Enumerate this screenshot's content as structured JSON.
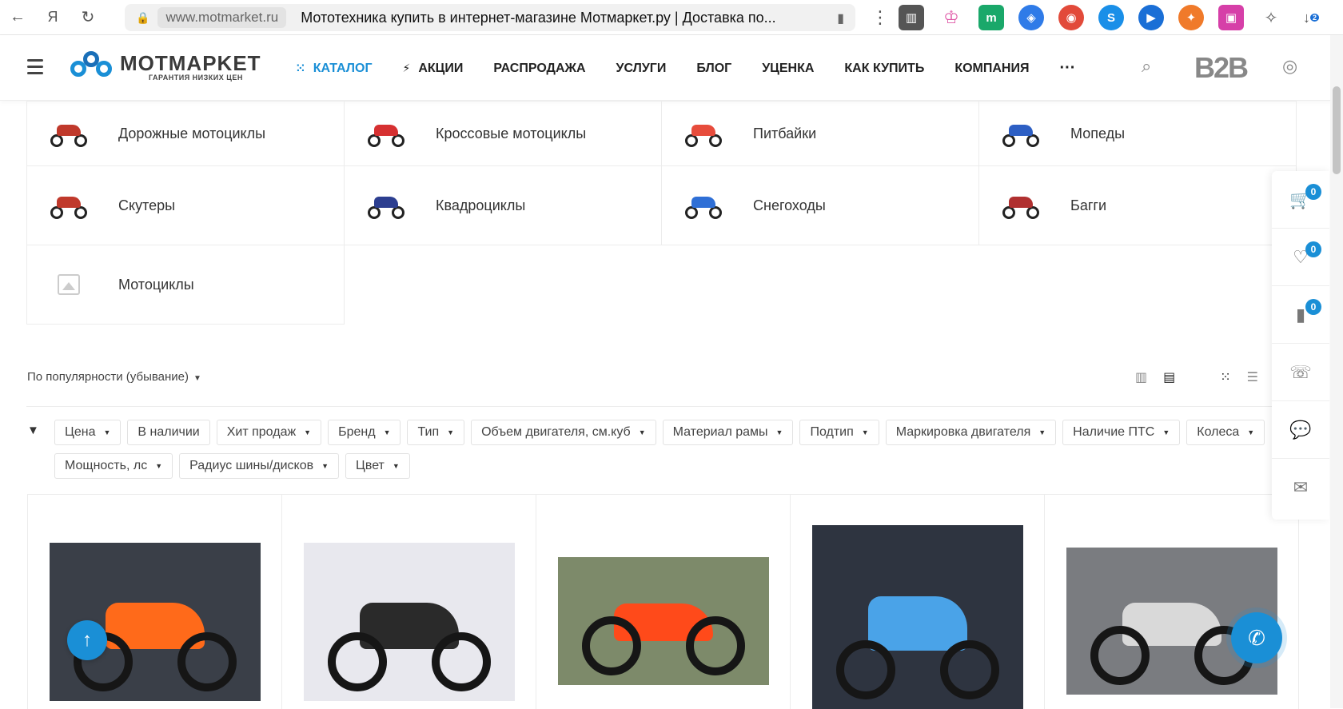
{
  "browser": {
    "url_domain": "www.motmarket.ru",
    "tab_title": "Мототехника купить в интернет-магазине Мотмаркет.ру | Доставка по...",
    "download_count": "2"
  },
  "header": {
    "logo_name": "MOTMAPKET",
    "logo_tagline": "ГАРАНТИЯ НИЗКИХ ЦЕН",
    "nav": [
      "КАТАЛОГ",
      "АКЦИИ",
      "РАСПРОДАЖА",
      "УСЛУГИ",
      "БЛОГ",
      "УЦЕНКА",
      "КАК КУПИТЬ",
      "КОМПАНИЯ"
    ],
    "b2b": "B2B",
    "more": "···"
  },
  "categories": [
    {
      "label": "Дорожные мотоциклы",
      "color": "#c0392b"
    },
    {
      "label": "Кроссовые мотоциклы",
      "color": "#d63031"
    },
    {
      "label": "Питбайки",
      "color": "#e74c3c"
    },
    {
      "label": "Мопеды",
      "color": "#2d5fc4"
    },
    {
      "label": "Скутеры",
      "color": "#c0392b"
    },
    {
      "label": "Квадроциклы",
      "color": "#2c3e90"
    },
    {
      "label": "Снегоходы",
      "color": "#2f6fd6"
    },
    {
      "label": "Багги",
      "color": "#b03030"
    },
    {
      "label": "Мотоциклы",
      "color": ""
    }
  ],
  "sort": {
    "label": "По популярности (убывание)"
  },
  "filters": [
    "Цена",
    "В наличии",
    "Хит продаж",
    "Бренд",
    "Тип",
    "Объем двигателя, см.куб",
    "Материал рамы",
    "Подтип",
    "Маркировка двигателя",
    "Наличие ПТС",
    "Колеса",
    "Мощность, лс",
    "Радиус шины/дисков",
    "Цвет"
  ],
  "filters_no_dropdown": [
    "В наличии"
  ],
  "side_panel": {
    "cart_count": "0",
    "favorites_count": "0",
    "compare_count": "0"
  },
  "products": [
    {
      "bg": "#3a3f48",
      "frame": "#ff6a1a"
    },
    {
      "bg": "#e8e8ee",
      "frame": "#2a2a2a"
    },
    {
      "bg": "#7d8a6a",
      "frame": "#ff4a1a"
    },
    {
      "bg": "#2e3440",
      "frame": "#4aa3e8"
    },
    {
      "bg": "#7a7c80",
      "frame": "#d9d9d9"
    }
  ]
}
